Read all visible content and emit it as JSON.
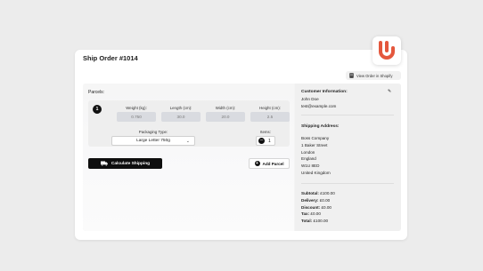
{
  "header": {
    "title": "Ship Order #1014",
    "view_shopify_label": "View Order in Shopify"
  },
  "parcels": {
    "section_label": "Parcels:",
    "items": [
      {
        "number": "1",
        "weight_label": "Weight (kg):",
        "weight_value": "0.750",
        "length_label": "Length (cm):",
        "length_value": "30.0",
        "width_label": "Width (cm):",
        "width_value": "20.0",
        "height_label": "Height (cm):",
        "height_value": "2.5",
        "packaging_label": "Packaging Type:",
        "packaging_value": "Large Letter 750g",
        "items_label": "Items:",
        "items_value": "1"
      }
    ],
    "calculate_label": "Calculate Shipping",
    "add_parcel_label": "Add Parcel"
  },
  "customer": {
    "heading": "Customer Information:",
    "name": "John Doe",
    "email": "test@example.com"
  },
  "shipping": {
    "heading": "Shipping Address:",
    "lines": [
      "Boss Company",
      "1 Baker Street",
      "London",
      "England",
      "W1U 8ED",
      "United Kingdom"
    ]
  },
  "totals": {
    "subtotal_label": "Subtotal:",
    "subtotal_value": "£100.00",
    "delivery_label": "Delivery:",
    "delivery_value": "£0.00",
    "discount_label": "Discount:",
    "discount_value": "£0.00",
    "tax_label": "Tax:",
    "tax_value": "£0.00",
    "total_label": "Total:",
    "total_value": "£100.00"
  },
  "colors": {
    "brand_accent": "#e4573d",
    "primary_button": "#0e0e0e",
    "background": "#ececec"
  }
}
